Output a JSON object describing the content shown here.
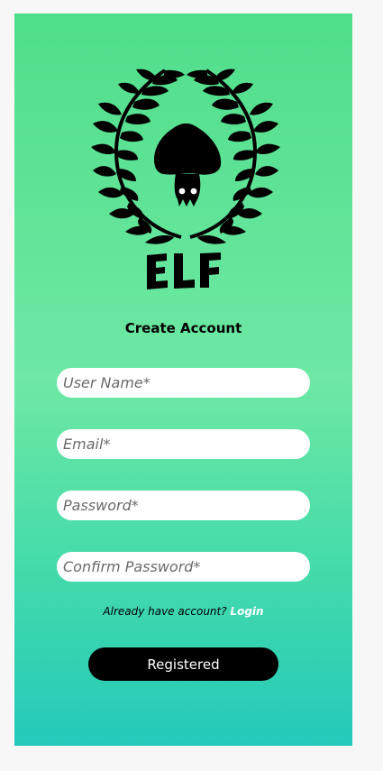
{
  "logo": {
    "text": "ELF",
    "icon": "mushroom-laurel-logo"
  },
  "form": {
    "title": "Create Account",
    "username_placeholder": "User Name*",
    "email_placeholder": "Email*",
    "password_placeholder": "Password*",
    "confirm_placeholder": "Confirm Password*"
  },
  "login": {
    "prompt": "Already have account? ",
    "link_label": "Login"
  },
  "register": {
    "label": "Registered"
  },
  "colors": {
    "gradient_top": "#50de8a",
    "gradient_bottom": "#24c9ba",
    "button": "#000000"
  }
}
